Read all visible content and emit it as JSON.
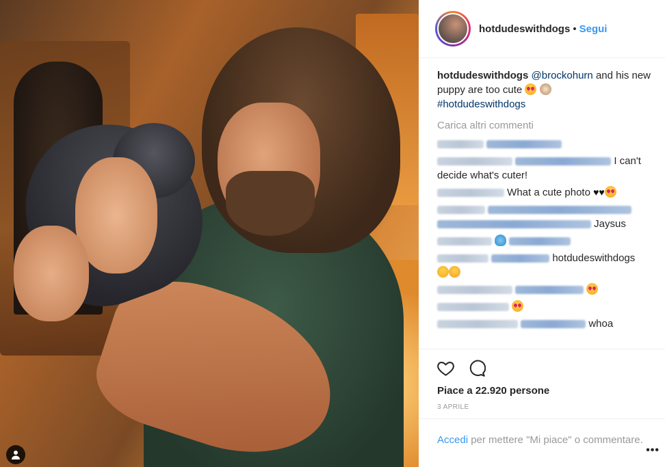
{
  "post": {
    "username": "hotdudeswithdogs",
    "separator": "•",
    "follow_label": "Segui"
  },
  "caption": {
    "username": "hotdudeswithdogs",
    "mention": "@brockohurn",
    "text": " and his new puppy are too cute ",
    "hashtag": "#hotdudeswithdogs"
  },
  "load_more_label": "Carica altri commenti",
  "comments": [
    {
      "text": ""
    },
    {
      "text": " I can't decide what's cuter!"
    },
    {
      "text": "What a cute photo "
    },
    {
      "text": "Jaysus"
    },
    {
      "text": ""
    },
    {
      "text": "hotdudeswithdogs"
    },
    {
      "text": ""
    },
    {
      "text": ""
    },
    {
      "text": "whoa"
    }
  ],
  "likes_text": "Piace a 22.920 persone",
  "date_text": "3 APRILE",
  "login": {
    "link_label": "Accedi",
    "rest_text": " per mettere \"Mi piace\" o commentare."
  },
  "more_options_label": "•••",
  "colors": {
    "link_blue": "#3897f0",
    "mention_navy": "#003569",
    "muted_gray": "#999999",
    "text_dark": "#262626"
  },
  "icons": {
    "like": "heart-outline-icon",
    "comment": "comment-bubble-icon",
    "user_tag": "user-tag-icon"
  }
}
